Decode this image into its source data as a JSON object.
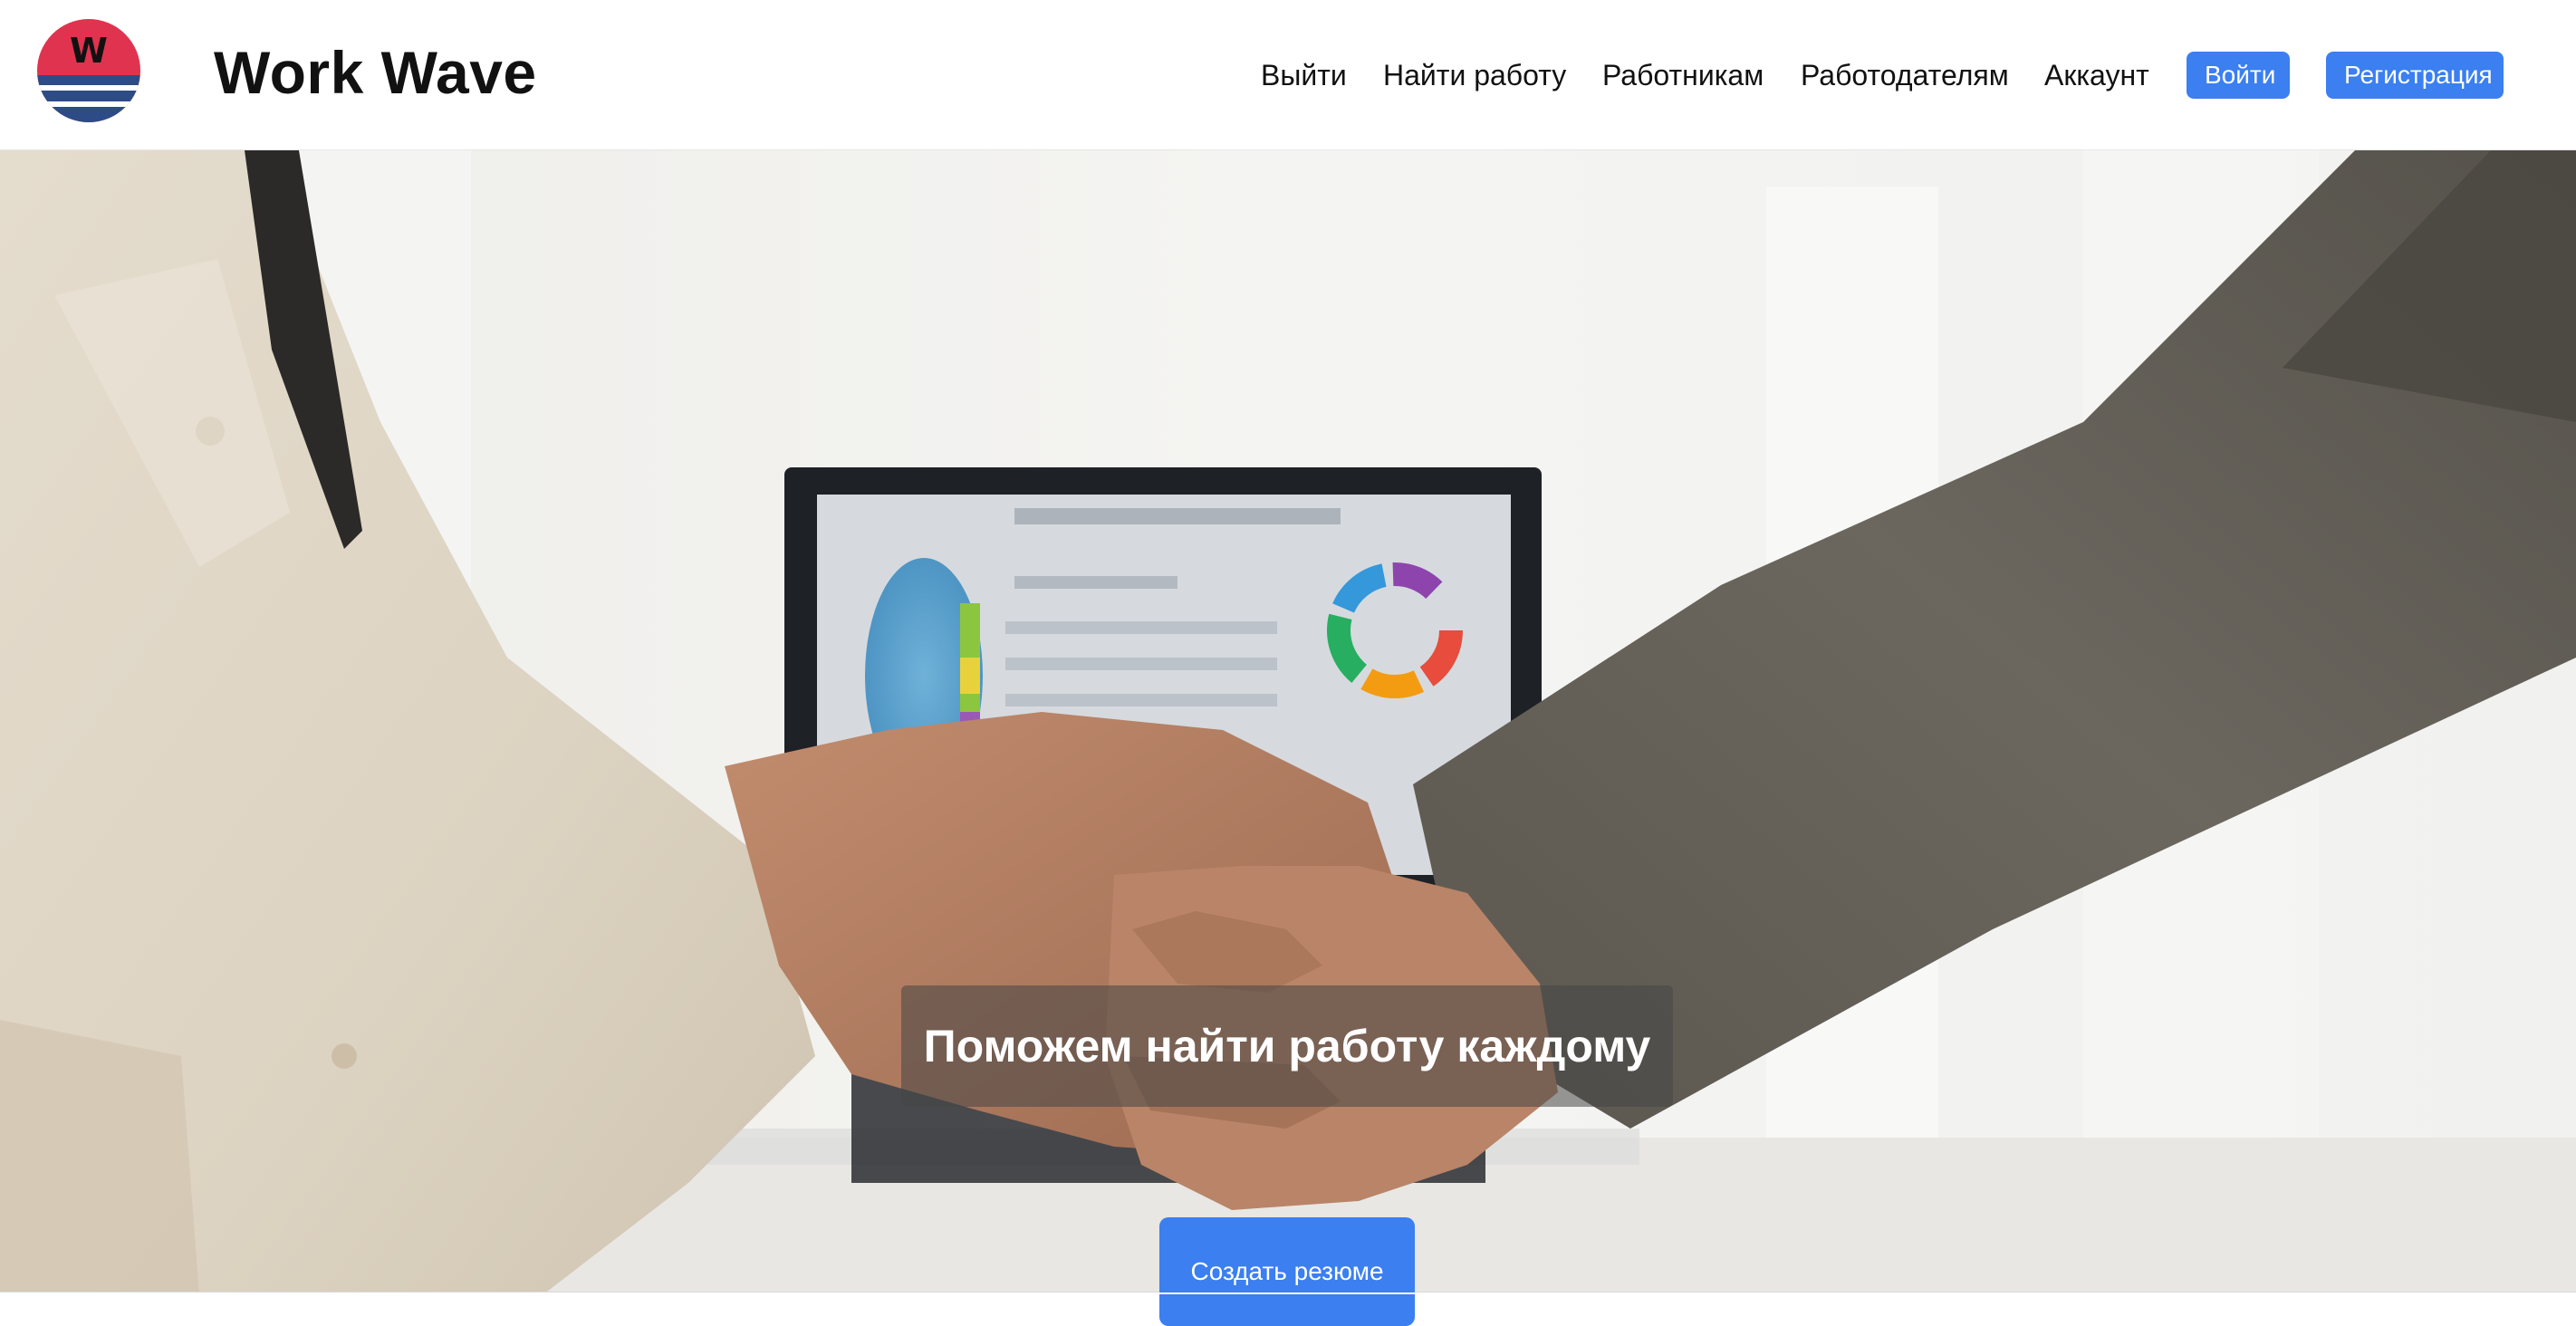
{
  "header": {
    "brand": "Work Wave",
    "logo_letter": "W",
    "nav": [
      {
        "label": "Выйти"
      },
      {
        "label": "Найти работу"
      },
      {
        "label": "Работникам"
      },
      {
        "label": "Работодателям"
      },
      {
        "label": "Аккаунт"
      }
    ],
    "login_label": "Войти",
    "register_label": "Регистрация"
  },
  "hero": {
    "tagline": "Поможем найти работу каждому",
    "cta_label": "Создать резюме"
  },
  "colors": {
    "accent": "#3b7ff0",
    "logo_red": "#e0334f",
    "logo_blue": "#2d4c86"
  }
}
